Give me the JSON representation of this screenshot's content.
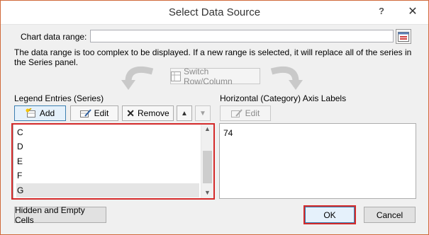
{
  "window": {
    "title": "Select Data Source",
    "help_glyph": "?",
    "close_glyph": "✕"
  },
  "range": {
    "label": "Chart data range:",
    "value": "",
    "message": "The data range is too complex to be displayed. If a new range is selected, it will replace all of the series in the Series panel."
  },
  "switch_button": "Switch Row/Column",
  "legend": {
    "heading": "Legend Entries (Series)",
    "add": "Add",
    "edit": "Edit",
    "remove": "Remove",
    "items": [
      "C",
      "D",
      "E",
      "F",
      "G"
    ],
    "selected_index": 4
  },
  "axis": {
    "heading": "Horizontal (Category) Axis Labels",
    "edit": "Edit",
    "items": [
      "74"
    ]
  },
  "footer": {
    "hidden_cells": "Hidden and Empty Cells",
    "ok": "OK",
    "cancel": "Cancel"
  },
  "colors": {
    "highlight": "#d42a2a",
    "accent": "#3c7fb1"
  }
}
